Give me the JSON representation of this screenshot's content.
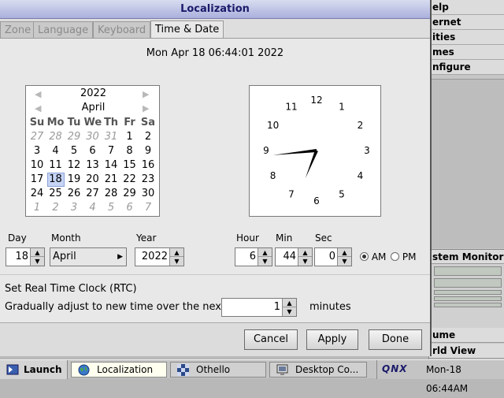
{
  "background_menu": {
    "items": [
      "elp",
      "ernet",
      "ities",
      "mes",
      "nfigure"
    ],
    "system_monitor": "stem Monitor",
    "volume": "ume",
    "world_view": "rld View"
  },
  "window": {
    "title": "Localization",
    "tabs": [
      {
        "label": "Zone",
        "active": false
      },
      {
        "label": "Language",
        "active": false
      },
      {
        "label": "Keyboard",
        "active": false
      },
      {
        "label": "Time & Date",
        "active": true
      }
    ],
    "current_datetime": "Mon Apr 18 06:44:01 2022"
  },
  "calendar": {
    "year": "2022",
    "month": "April",
    "weekdays": [
      "Su",
      "Mo",
      "Tu",
      "We",
      "Th",
      "Fr",
      "Sa"
    ],
    "weeks": [
      [
        "27",
        "28",
        "29",
        "30",
        "31",
        "1",
        "2"
      ],
      [
        "3",
        "4",
        "5",
        "6",
        "7",
        "8",
        "9"
      ],
      [
        "10",
        "11",
        "12",
        "13",
        "14",
        "15",
        "16"
      ],
      [
        "17",
        "18",
        "19",
        "20",
        "21",
        "22",
        "23"
      ],
      [
        "24",
        "25",
        "26",
        "27",
        "28",
        "29",
        "30"
      ],
      [
        "1",
        "2",
        "3",
        "4",
        "5",
        "6",
        "7"
      ]
    ],
    "selected_day": "18",
    "prev_icon": "triangle-left-icon",
    "next_icon": "triangle-right-icon"
  },
  "clock": {
    "numbers": [
      "12",
      "1",
      "2",
      "3",
      "4",
      "5",
      "6",
      "7",
      "8",
      "9",
      "10",
      "11"
    ],
    "hour": 6,
    "minute": 44
  },
  "date_fields": {
    "day_label": "Day",
    "day_value": "18",
    "month_label": "Month",
    "month_value": "April",
    "year_label": "Year",
    "year_value": "2022"
  },
  "time_fields": {
    "hour_label": "Hour",
    "hour_value": "6",
    "min_label": "Min",
    "min_value": "44",
    "sec_label": "Sec",
    "sec_value": "0",
    "am_label": "AM",
    "pm_label": "PM",
    "am_selected": true
  },
  "rtc": {
    "title": "Set Real Time Clock (RTC)",
    "adjust_label": "Gradually adjust to new time over the next",
    "adjust_value": "1",
    "unit_label": "minutes"
  },
  "buttons": {
    "cancel": "Cancel",
    "apply": "Apply",
    "done": "Done"
  },
  "taskbar": {
    "launch": "Launch",
    "tasks": [
      {
        "label": "Localization",
        "active": true
      },
      {
        "label": "Othello",
        "active": false
      },
      {
        "label": "Desktop Co...",
        "active": false
      }
    ],
    "logo": "QNX",
    "clock": "Mon-18 06:44AM"
  },
  "colors": {
    "title_text": "#1a1a6a",
    "selected_day_bg": "#c6d4f5"
  }
}
